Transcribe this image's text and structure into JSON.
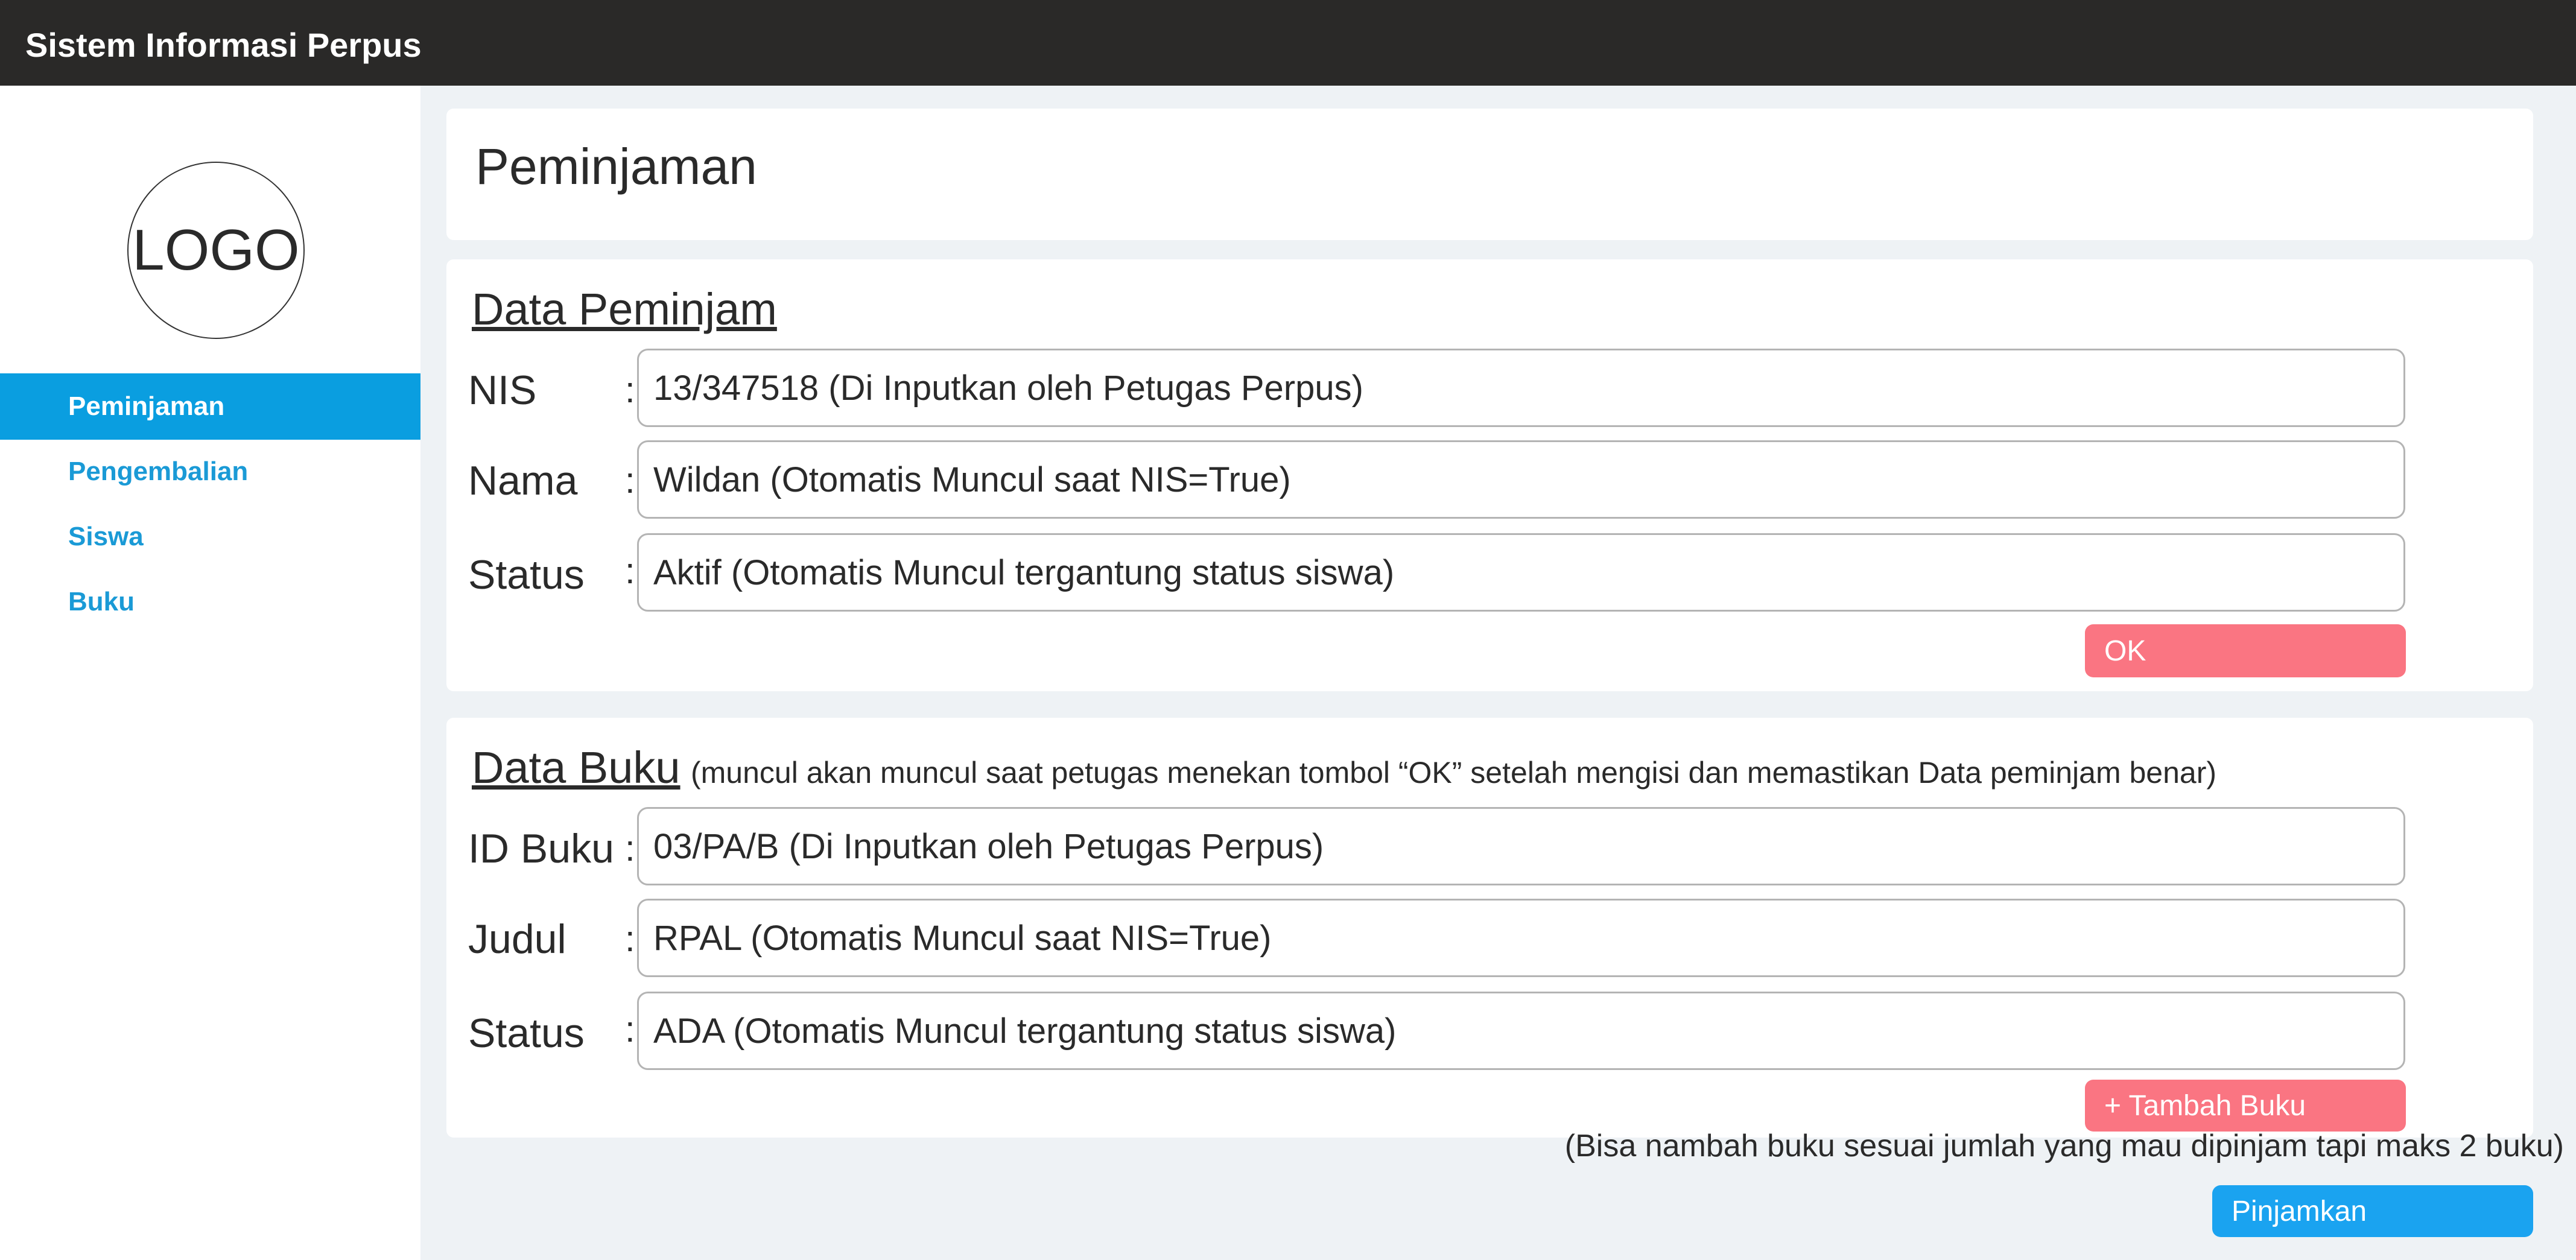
{
  "app": {
    "title": "Sistem Informasi Perpus"
  },
  "sidebar": {
    "logo_text": "LOGO",
    "items": [
      {
        "label": "Peminjaman",
        "active": true
      },
      {
        "label": "Pengembalian",
        "active": false
      },
      {
        "label": "Siswa",
        "active": false
      },
      {
        "label": "Buku",
        "active": false
      }
    ]
  },
  "page": {
    "title": "Peminjaman"
  },
  "peminjam": {
    "title": "Data Peminjam",
    "fields": [
      {
        "label": "NIS",
        "colon": ":",
        "value": "13/347518 (Di Inputkan oleh Petugas Perpus)"
      },
      {
        "label": "Nama",
        "colon": ":",
        "value": "Wildan (Otomatis Muncul saat NIS=True)"
      },
      {
        "label": "Status",
        "colon": ":",
        "value": "Aktif (Otomatis Muncul tergantung status siswa)"
      }
    ],
    "ok_label": "OK"
  },
  "buku": {
    "title": "Data Buku",
    "note": "(muncul akan muncul saat petugas menekan tombol “OK” setelah mengisi dan memastikan Data peminjam benar)",
    "fields": [
      {
        "label": "ID Buku",
        "colon": ":",
        "value": "03/PA/B (Di Inputkan oleh Petugas Perpus)"
      },
      {
        "label": "Judul",
        "colon": ":",
        "value": "RPAL (Otomatis Muncul saat NIS=True)"
      },
      {
        "label": "Status",
        "colon": ":",
        "value": "ADA (Otomatis Muncul tergantung status siswa)"
      }
    ],
    "add_label": "+ Tambah Buku",
    "hint": "(Bisa nambah buku sesuai jumlah yang mau dipinjam tapi maks 2 buku)"
  },
  "actions": {
    "submit_label": "Pinjamkan"
  },
  "colors": {
    "topbar": "#2a2928",
    "accent": "#0a9ee0",
    "button_red": "#fa7582",
    "button_blue": "#1aa3f0"
  }
}
